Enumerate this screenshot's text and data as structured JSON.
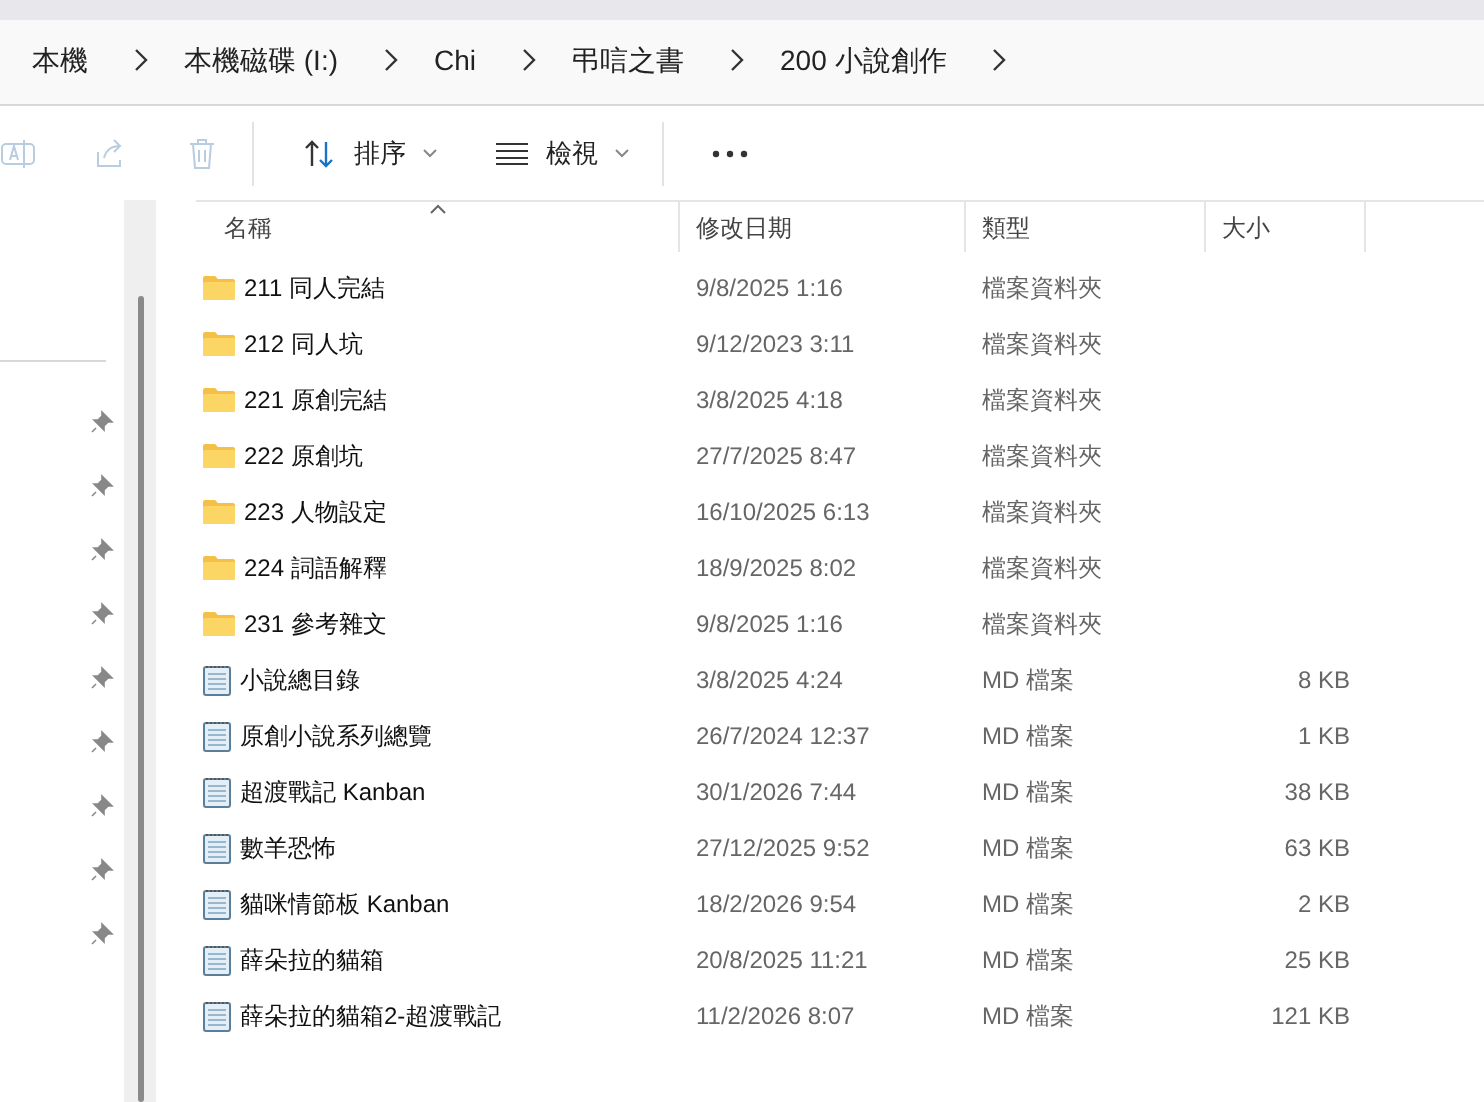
{
  "breadcrumb": [
    "本機",
    "本機磁碟 (I:)",
    "Chi",
    "弔唁之書",
    "200 小說創作"
  ],
  "toolbar": [
    {
      "kind": "rename",
      "disabled": true
    },
    {
      "kind": "share",
      "disabled": true
    },
    {
      "kind": "delete",
      "disabled": true
    },
    {
      "kind": "sort",
      "label": "排序",
      "disabled": false
    },
    {
      "kind": "view",
      "label": "檢視",
      "disabled": false
    },
    {
      "kind": "more",
      "disabled": false
    }
  ],
  "sidebar": {
    "items": [
      {
        "pinned": true
      },
      {
        "pinned": true
      },
      {
        "pinned": true
      },
      {
        "pinned": true
      },
      {
        "pinned": true
      },
      {
        "pinned": true
      },
      {
        "pinned": true
      },
      {
        "pinned": true
      },
      {
        "pinned": true
      }
    ]
  },
  "table": {
    "columns": [
      {
        "label": "名稱",
        "sorted": true
      },
      {
        "label": "修改日期",
        "sorted": false
      },
      {
        "label": "類型",
        "sorted": false
      },
      {
        "label": "大小",
        "sorted": false
      }
    ],
    "rows": [
      {
        "kind": "folder",
        "name": "211 同人完結",
        "date": "9/8/2025 1:16",
        "type": "檔案資料夾"
      },
      {
        "kind": "folder",
        "name": "212 同人坑",
        "date": "9/12/2023 3:11",
        "type": "檔案資料夾"
      },
      {
        "kind": "folder",
        "name": "221 原創完結",
        "date": "3/8/2025 4:18",
        "type": "檔案資料夾"
      },
      {
        "kind": "folder",
        "name": "222 原創坑",
        "date": "27/7/2025 8:47",
        "type": "檔案資料夾"
      },
      {
        "kind": "folder",
        "name": "223 人物設定",
        "date": "16/10/2025 6:13",
        "type": "檔案資料夾"
      },
      {
        "kind": "folder",
        "name": "224 詞語解釋",
        "date": "18/9/2025 8:02",
        "type": "檔案資料夾"
      },
      {
        "kind": "folder",
        "name": "231 參考雜文",
        "date": "9/8/2025 1:16",
        "type": "檔案資料夾"
      },
      {
        "kind": "file",
        "name": "小說總目錄",
        "date": "3/8/2025 4:24",
        "type": "MD 檔案",
        "size": "8 KB"
      },
      {
        "kind": "file",
        "name": "原創小說系列總覽",
        "date": "26/7/2024 12:37",
        "type": "MD 檔案",
        "size": "1 KB"
      },
      {
        "kind": "file",
        "name": "超渡戰記 Kanban",
        "date": "30/1/2026 7:44",
        "type": "MD 檔案",
        "size": "38 KB"
      },
      {
        "kind": "file",
        "name": "數羊恐怖",
        "date": "27/12/2025 9:52",
        "type": "MD 檔案",
        "size": "63 KB"
      },
      {
        "kind": "file",
        "name": "貓咪情節板 Kanban",
        "date": "18/2/2026 9:54",
        "type": "MD 檔案",
        "size": "2 KB"
      },
      {
        "kind": "file",
        "name": "薛朵拉的貓箱",
        "date": "20/8/2025 11:21",
        "type": "MD 檔案",
        "size": "25 KB"
      },
      {
        "kind": "file",
        "name": "薛朵拉的貓箱2-超渡戰記",
        "date": "11/2/2026 8:07",
        "type": "MD 檔案",
        "size": "121 KB"
      }
    ]
  }
}
